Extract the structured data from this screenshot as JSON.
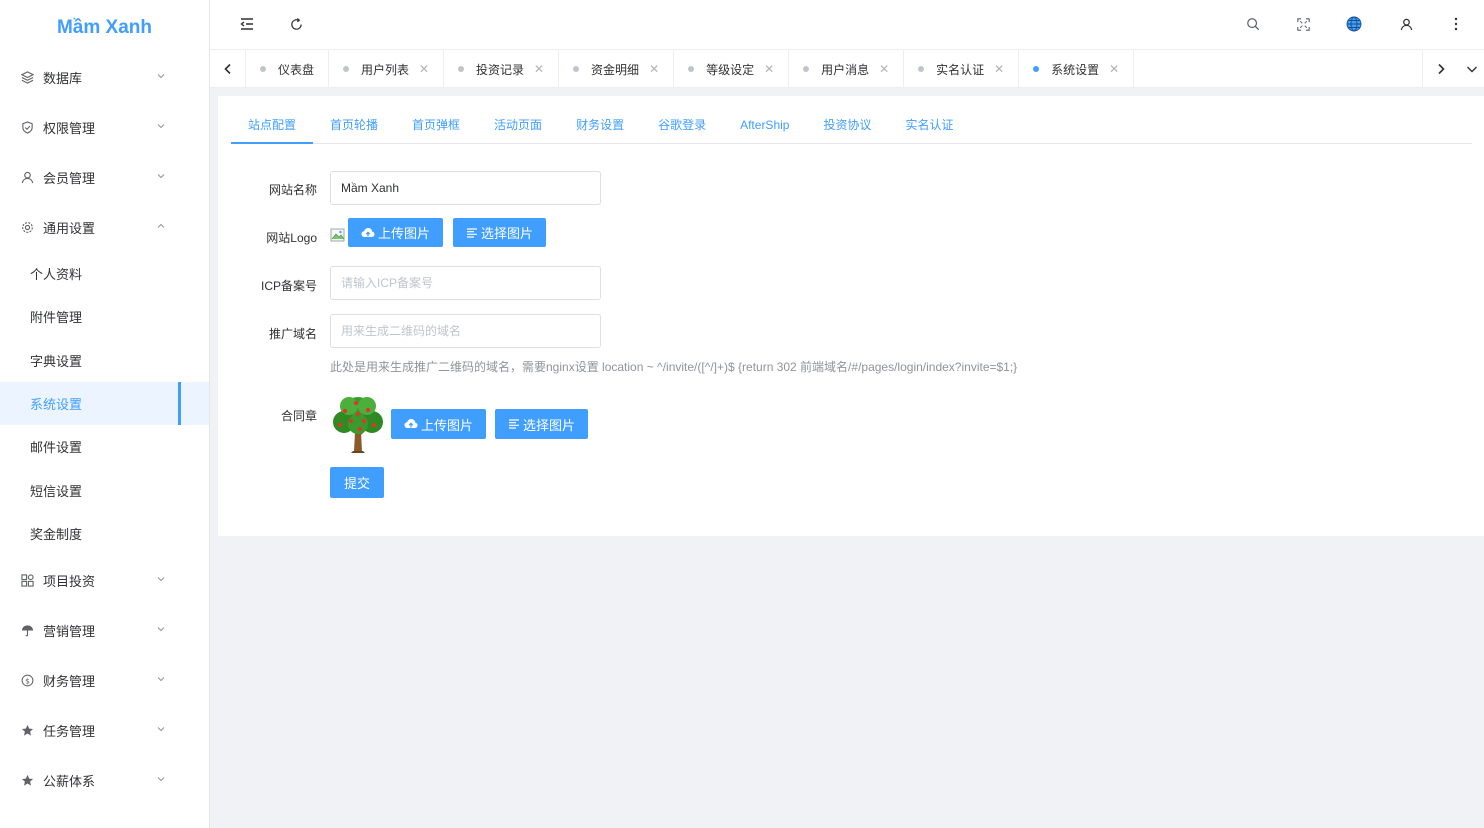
{
  "app": {
    "logo": "Mầm Xanh"
  },
  "colors": {
    "accent": "#409eff",
    "sidebar_active_bg": "#ecf5ff"
  },
  "sidebar": {
    "top_items": [
      {
        "label": "数据库",
        "icon": "layers-icon"
      },
      {
        "label": "权限管理",
        "icon": "shield-check-icon"
      },
      {
        "label": "会员管理",
        "icon": "user-icon"
      },
      {
        "label": "通用设置",
        "icon": "gear-icon"
      }
    ],
    "sub_items": [
      {
        "label": "个人资料"
      },
      {
        "label": "附件管理"
      },
      {
        "label": "字典设置"
      },
      {
        "label": "系统设置"
      },
      {
        "label": "邮件设置"
      },
      {
        "label": "短信设置"
      },
      {
        "label": "奖金制度"
      }
    ],
    "bottom_items": [
      {
        "label": "项目投资",
        "icon": "grid-icon"
      },
      {
        "label": "营销管理",
        "icon": "umbrella-icon"
      },
      {
        "label": "财务管理",
        "icon": "coin-icon"
      },
      {
        "label": "任务管理",
        "icon": "star-icon"
      },
      {
        "label": "公薪体系",
        "icon": "star-icon"
      }
    ]
  },
  "tabs": [
    {
      "label": "仪表盘"
    },
    {
      "label": "用户列表"
    },
    {
      "label": "投资记录"
    },
    {
      "label": "资金明细"
    },
    {
      "label": "等级设定"
    },
    {
      "label": "用户消息"
    },
    {
      "label": "实名认证"
    },
    {
      "label": "系统设置"
    }
  ],
  "subtabs": [
    {
      "label": "站点配置"
    },
    {
      "label": "首页轮播"
    },
    {
      "label": "首页弹框"
    },
    {
      "label": "活动页面"
    },
    {
      "label": "财务设置"
    },
    {
      "label": "谷歌登录"
    },
    {
      "label": "AfterShip"
    },
    {
      "label": "投资协议"
    },
    {
      "label": "实名认证"
    }
  ],
  "form": {
    "site_name": {
      "label": "网站名称",
      "value": "Mầm Xanh"
    },
    "logo": {
      "label": "网站Logo",
      "upload": "上传图片",
      "choose": "选择图片"
    },
    "icp": {
      "label": "ICP备案号",
      "placeholder": "请输入ICP备案号"
    },
    "promo_domain": {
      "label": "推广域名",
      "placeholder": "用来生成二维码的域名",
      "hint": "此处是用来生成推广二维码的域名，需要nginx设置 location ~ ^/invite/([^/]+)$ {return 302 前端域名/#/pages/login/index?invite=$1;}"
    },
    "contract_seal": {
      "label": "合同章",
      "upload": "上传图片",
      "choose": "选择图片"
    },
    "submit": "提交"
  }
}
